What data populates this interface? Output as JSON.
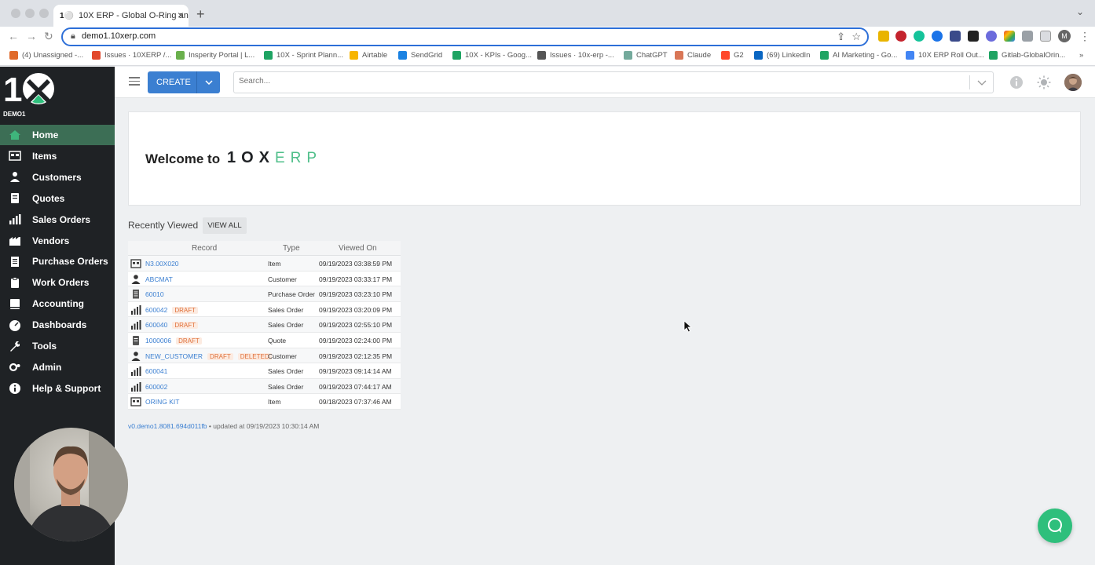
{
  "browser": {
    "tab_title": "10X ERP - Global O-Ring and S",
    "tab_favicon": "1⚪",
    "new_tab": "+",
    "url": "demo1.10xerp.com",
    "profile_initial": "M",
    "bookmarks": [
      {
        "label": "(4) Unassigned -...",
        "color": "#e06a2b"
      },
      {
        "label": "Issues · 10XERP /...",
        "color": "#e2492d"
      },
      {
        "label": "Insperity Portal | L...",
        "color": "#6ab04c"
      },
      {
        "label": "10X - Sprint Plann...",
        "color": "#1fa463"
      },
      {
        "label": "Airtable",
        "color": "#f7b500"
      },
      {
        "label": "SendGrid",
        "color": "#1a82e2"
      },
      {
        "label": "10X - KPIs - Goog...",
        "color": "#1fa463"
      },
      {
        "label": "Issues · 10x-erp -...",
        "color": "#555555"
      },
      {
        "label": "ChatGPT",
        "color": "#74aa9c"
      },
      {
        "label": "Claude",
        "color": "#d97757"
      },
      {
        "label": "G2",
        "color": "#ff492c"
      },
      {
        "label": "(69) LinkedIn",
        "color": "#0a66c2"
      },
      {
        "label": "AI Marketing - Go...",
        "color": "#1fa463"
      },
      {
        "label": "10X ERP Roll Out...",
        "color": "#4285f4"
      },
      {
        "label": "Gitlab-GlobalOrin...",
        "color": "#1fa463"
      }
    ],
    "more": "»"
  },
  "sidebar": {
    "logo": "1",
    "org": "DEMO1",
    "items": [
      {
        "label": "Home",
        "icon": "home-icon"
      },
      {
        "label": "Items",
        "icon": "items-icon"
      },
      {
        "label": "Customers",
        "icon": "customers-icon"
      },
      {
        "label": "Quotes",
        "icon": "quotes-icon"
      },
      {
        "label": "Sales Orders",
        "icon": "sales-orders-icon"
      },
      {
        "label": "Vendors",
        "icon": "vendors-icon"
      },
      {
        "label": "Purchase Orders",
        "icon": "purchase-orders-icon"
      },
      {
        "label": "Work Orders",
        "icon": "work-orders-icon"
      },
      {
        "label": "Accounting",
        "icon": "accounting-icon"
      },
      {
        "label": "Dashboards",
        "icon": "dashboards-icon"
      },
      {
        "label": "Tools",
        "icon": "tools-icon"
      },
      {
        "label": "Admin",
        "icon": "admin-icon"
      },
      {
        "label": "Help & Support",
        "icon": "help-icon"
      }
    ],
    "active": "Home"
  },
  "header": {
    "create_label": "CREATE",
    "search_placeholder": "Search..."
  },
  "welcome": {
    "text": "Welcome to",
    "logo_dark": "1OX",
    "logo_light": "ERP"
  },
  "recently_viewed": {
    "title": "Recently Viewed",
    "view_all": "VIEW ALL",
    "columns": [
      "Record",
      "Type",
      "Viewed On"
    ],
    "rows": [
      {
        "record": "N3.00X020",
        "tags": [],
        "type": "Item",
        "viewed": "09/19/2023  03:38:59 PM",
        "icon": "item-icon"
      },
      {
        "record": "ABCMAT",
        "tags": [],
        "type": "Customer",
        "viewed": "09/19/2023  03:33:17 PM",
        "icon": "customer-icon"
      },
      {
        "record": "60010",
        "tags": [],
        "type": "Purchase Order",
        "viewed": "09/19/2023  03:23:10 PM",
        "icon": "purchase-order-icon"
      },
      {
        "record": "600042",
        "tags": [
          "DRAFT"
        ],
        "type": "Sales Order",
        "viewed": "09/19/2023  03:20:09 PM",
        "icon": "sales-order-icon"
      },
      {
        "record": "600040",
        "tags": [
          "DRAFT"
        ],
        "type": "Sales Order",
        "viewed": "09/19/2023  02:55:10 PM",
        "icon": "sales-order-icon"
      },
      {
        "record": "1000006",
        "tags": [
          "DRAFT"
        ],
        "type": "Quote",
        "viewed": "09/19/2023  02:24:00 PM",
        "icon": "quote-icon"
      },
      {
        "record": "NEW_CUSTOMER",
        "tags": [
          "DRAFT",
          "DELETED"
        ],
        "type": "Customer",
        "viewed": "09/19/2023  02:12:35 PM",
        "icon": "customer-icon"
      },
      {
        "record": "600041",
        "tags": [],
        "type": "Sales Order",
        "viewed": "09/19/2023  09:14:14 AM",
        "icon": "sales-order-icon"
      },
      {
        "record": "600002",
        "tags": [],
        "type": "Sales Order",
        "viewed": "09/19/2023  07:44:17 AM",
        "icon": "sales-order-icon"
      },
      {
        "record": "ORING KIT",
        "tags": [],
        "type": "Item",
        "viewed": "09/18/2023  07:37:46 AM",
        "icon": "item-icon"
      }
    ]
  },
  "footer": {
    "version": "v0.demo1.8081.694d011fb",
    "updated": " • updated at 09/19/2023 10:30:14 AM"
  },
  "colors": {
    "sidebar_bg": "#1f2225",
    "active_nav": "#3c6e55",
    "primary": "#3b7fd1",
    "accent_green": "#2ebf7c",
    "draft_tag": "#e0703a"
  }
}
